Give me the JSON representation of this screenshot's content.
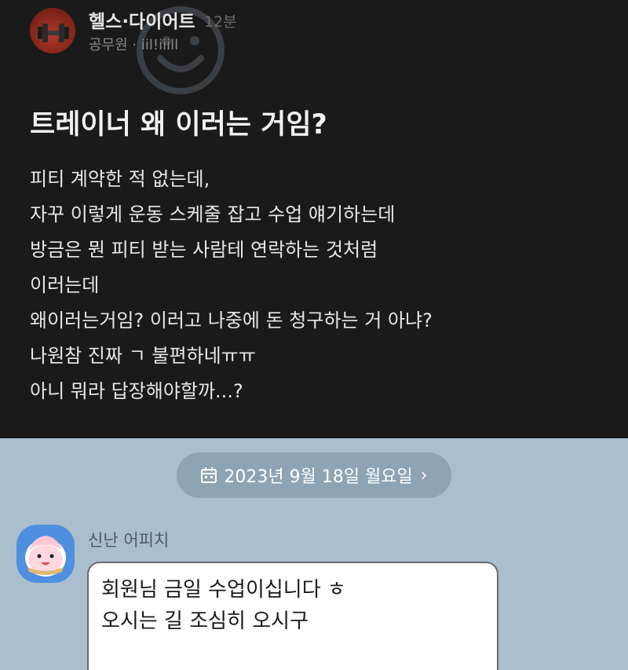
{
  "post": {
    "board_name": "헬스·다이어트",
    "time": "12분",
    "author": "공무원 · iil!iiill",
    "title": "트레이너 왜 이러는 거임?",
    "body": [
      "피티 계약한 적 없는데,",
      "자꾸 이렇게 운동 스케줄 잡고 수업 얘기하는데",
      "방금은 뭔 피티 받는 사람테 연락하는 것처럼",
      "이러는데",
      "왜이러는거임? 이러고 나중에 돈 청구하는 거 아냐?",
      "나원참 진짜 ㄱ 불편하네ㅠㅠ",
      "아니 뭐라 답장해야할까...?"
    ]
  },
  "chat": {
    "date": "2023년 9월 18일 월요일",
    "date_chevron": "›",
    "sender": "신난 어피치",
    "message_lines": [
      "회원님 금일 수업이십니다 ㅎ",
      "오시는 길 조심히 오시구"
    ]
  },
  "colors": {
    "post_bg": "#1a1a1a",
    "chat_bg": "#a9bfce",
    "pill_bg": "#8ea4b4",
    "avatar_bg": "#4e8fe0"
  },
  "icons": {
    "watermark": "smiley-watermark-icon",
    "profile": "dumbbell-avatar",
    "calendar": "calendar-icon",
    "sender_avatar": "apeach-avatar"
  }
}
